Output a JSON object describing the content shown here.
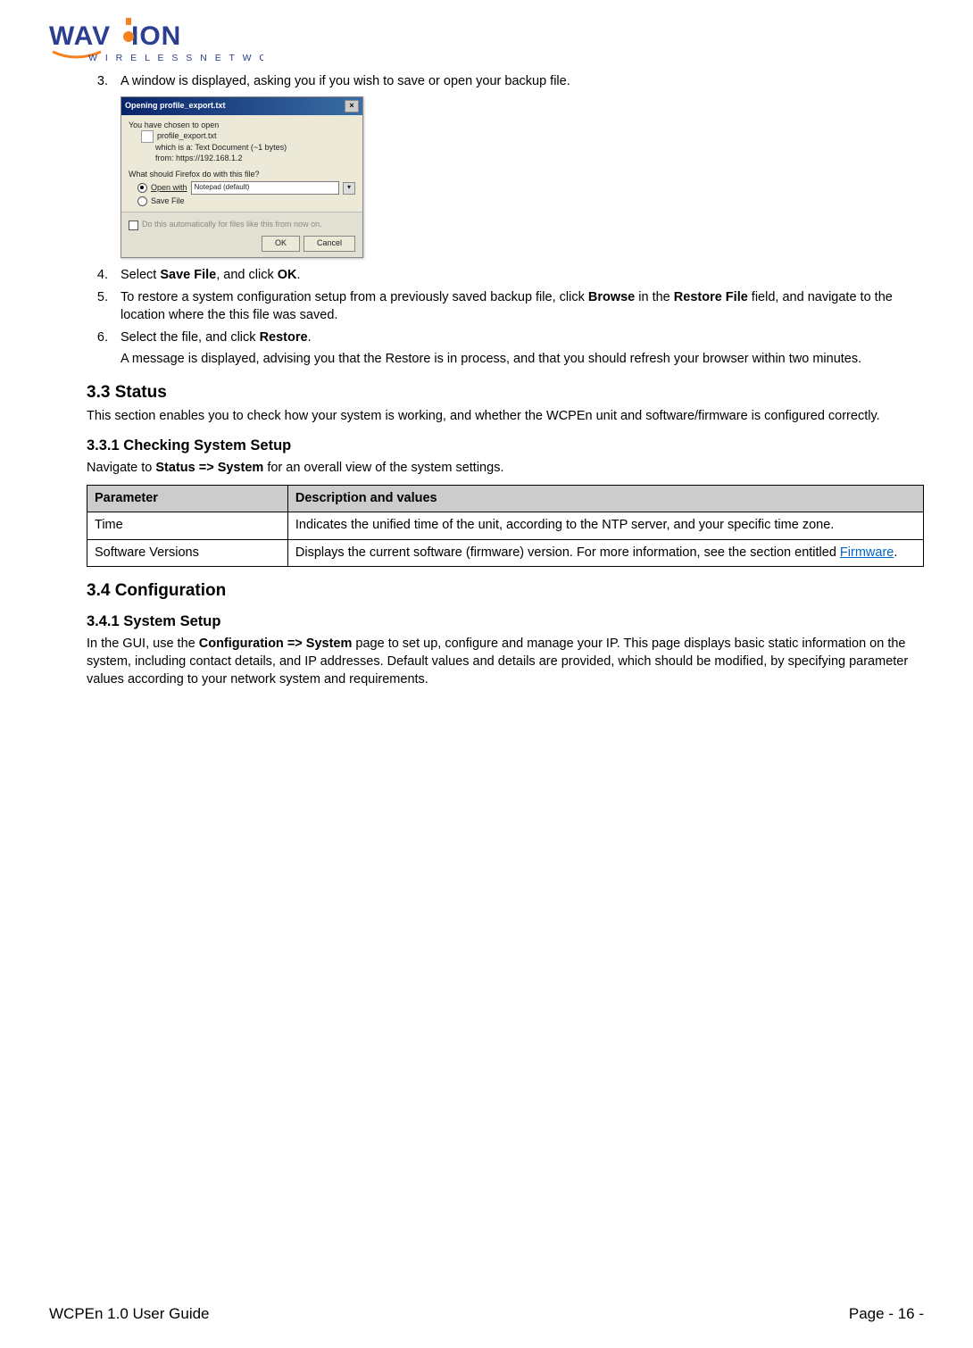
{
  "logo": {
    "brand": "WAVION",
    "tagline": "W I R E L E S S   N E T W O R K S"
  },
  "steps": {
    "s3": {
      "num": "3.",
      "text": "A window is displayed, asking you if you wish to save or open your backup file."
    },
    "s4": {
      "num": "4.",
      "parts": [
        "Select ",
        "Save File",
        ", and click ",
        "OK",
        "."
      ]
    },
    "s5": {
      "num": "5.",
      "parts": [
        "To restore a system configuration setup from a previously saved backup file, click ",
        "Browse",
        " in the ",
        "Restore File",
        " field, and navigate to the location where the this file was saved."
      ]
    },
    "s6": {
      "num": "6.",
      "parts": [
        "Select the file, and click ",
        "Restore",
        "."
      ],
      "sub": "A message is displayed, advising you that the Restore is in process, and that you should refresh your browser within two minutes."
    }
  },
  "dialog": {
    "title": "Opening profile_export.txt",
    "line1": "You have chosen to open",
    "filename": "profile_export.txt",
    "meta1": "which is a: Text Document (~1 bytes)",
    "meta2": "from: https://192.168.1.2",
    "question": "What should Firefox do with this file?",
    "open_label": "Open with",
    "open_value": "Notepad (default)",
    "save_label": "Save File",
    "checkbox_label": "Do this automatically for files like this from now on.",
    "ok": "OK",
    "cancel": "Cancel"
  },
  "sec33": {
    "heading": "3.3    Status",
    "body": "This section enables you to check how your system is working, and whether the WCPEn unit and software/firmware is configured correctly."
  },
  "sec331": {
    "heading": "3.3.1    Checking System Setup",
    "body_parts": [
      "Navigate to ",
      "Status => System",
      " for an overall view of the system settings."
    ]
  },
  "table": {
    "h1": "Parameter",
    "h2": "Description and values",
    "rows": [
      {
        "p": "Time",
        "d": "Indicates the unified time of the unit, according to the NTP server, and your specific time zone."
      },
      {
        "p": "Software Versions",
        "d_pre": "Displays the current software (firmware) version. For more information, see the section entitled ",
        "d_link": "Firmware",
        "d_post": "."
      }
    ]
  },
  "sec34": {
    "heading": "3.4    Configuration"
  },
  "sec341": {
    "heading": "3.4.1    System Setup",
    "body_parts": [
      "In the GUI, use the ",
      "Configuration => System",
      " page to set up, configure and manage your IP. This page displays basic static information on the system, including contact details, and IP addresses. Default values and details are provided, which should be modified, by specifying parameter values according to your network system and requirements."
    ]
  },
  "footer": {
    "left": "WCPEn 1.0 User Guide",
    "right": "Page - 16 -"
  }
}
